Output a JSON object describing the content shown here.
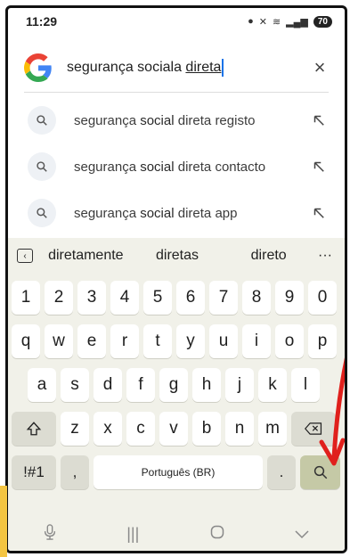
{
  "status": {
    "time": "11:29",
    "battery": "70"
  },
  "search": {
    "query_prefix": "segurança sociala ",
    "query_underlined": "direta",
    "clear_label": "×"
  },
  "suggestions": [
    {
      "prefix": "segurança ",
      "bold": "social",
      "mid": " direta ",
      "suffix": "registo"
    },
    {
      "prefix": "segurança ",
      "bold": "social",
      "mid": " direta ",
      "suffix": "contacto"
    },
    {
      "prefix": "segurança ",
      "bold": "social",
      "mid": " direta ",
      "suffix": "app"
    }
  ],
  "keyboard": {
    "predictions": [
      "diretamente",
      "diretas",
      "direto"
    ],
    "more": "···",
    "numbers": [
      "1",
      "2",
      "3",
      "4",
      "5",
      "6",
      "7",
      "8",
      "9",
      "0"
    ],
    "row1": [
      "q",
      "w",
      "e",
      "r",
      "t",
      "y",
      "u",
      "i",
      "o",
      "p"
    ],
    "row2": [
      "a",
      "s",
      "d",
      "f",
      "g",
      "h",
      "j",
      "k",
      "l"
    ],
    "row3": [
      "z",
      "x",
      "c",
      "v",
      "b",
      "n",
      "m"
    ],
    "symbols_label": "!#1",
    "comma": ",",
    "space_label": "Português (BR)",
    "period": ".",
    "accent_color": "#c5c9a6"
  }
}
